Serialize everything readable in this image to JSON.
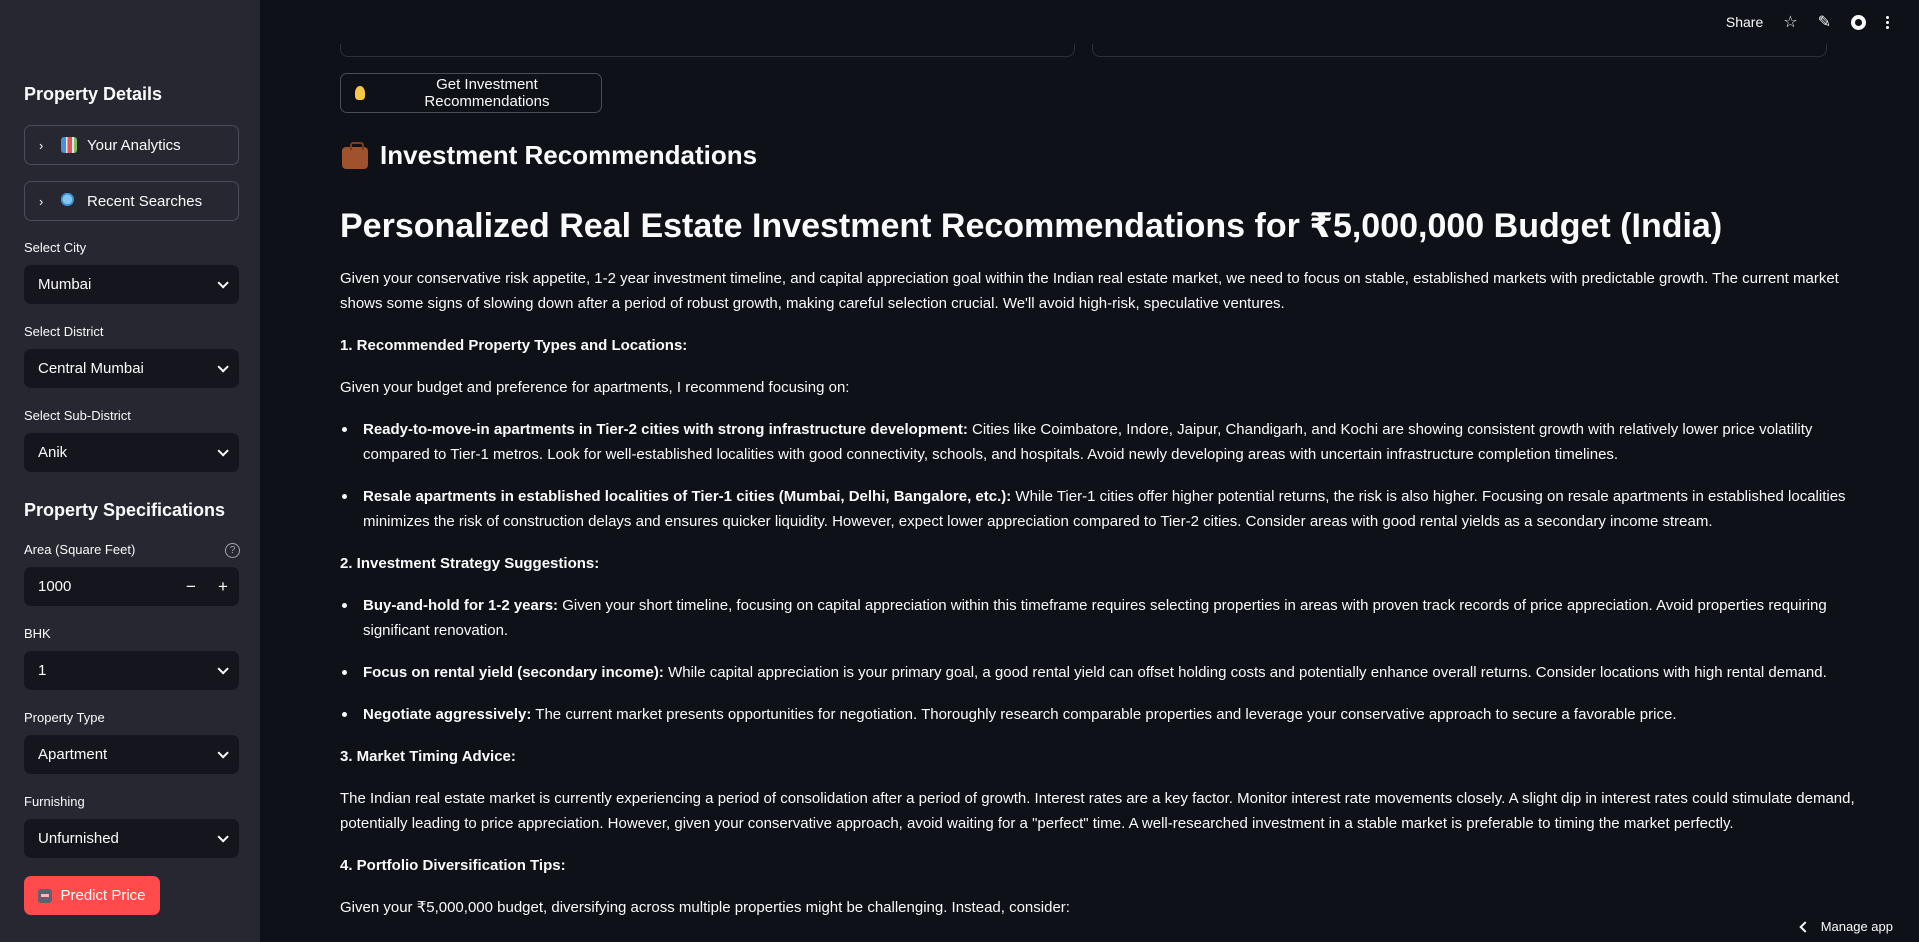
{
  "sidebar": {
    "title": "Property Details",
    "expanders": [
      {
        "label": "Your Analytics",
        "icon": "chart-icon"
      },
      {
        "label": "Recent Searches",
        "icon": "magnifier-icon"
      }
    ],
    "city": {
      "label": "Select City",
      "value": "Mumbai"
    },
    "district": {
      "label": "Select District",
      "value": "Central Mumbai"
    },
    "subdistrict": {
      "label": "Select Sub-District",
      "value": "Anik"
    },
    "spec_title": "Property Specifications",
    "area": {
      "label": "Area (Square Feet)",
      "value": "1000",
      "help": "?",
      "minus": "−",
      "plus": "+"
    },
    "bhk": {
      "label": "BHK",
      "value": "1"
    },
    "property_type": {
      "label": "Property Type",
      "value": "Apartment"
    },
    "furnishing": {
      "label": "Furnishing",
      "value": "Unfurnished"
    },
    "predict_label": "Predict Price"
  },
  "topbar": {
    "share": "Share",
    "star": "☆",
    "edit": "✎"
  },
  "main": {
    "rec_button_label": "Get Investment Recommendations",
    "rec_heading": "Investment Recommendations",
    "h1": "Personalized Real Estate Investment Recommendations for ₹5,000,000 Budget (India)",
    "intro": "Given your conservative risk appetite, 1-2 year investment timeline, and capital appreciation goal within the Indian real estate market, we need to focus on stable, established markets with predictable growth. The current market shows some signs of slowing down after a period of robust growth, making careful selection crucial. We'll avoid high-risk, speculative ventures.",
    "sec1_title": "1. Recommended Property Types and Locations:",
    "sec1_intro": "Given your budget and preference for apartments, I recommend focusing on:",
    "sec1_items": [
      {
        "bold": "Ready-to-move-in apartments in Tier-2 cities with strong infrastructure development:",
        "text": " Cities like Coimbatore, Indore, Jaipur, Chandigarh, and Kochi are showing consistent growth with relatively lower price volatility compared to Tier-1 metros. Look for well-established localities with good connectivity, schools, and hospitals. Avoid newly developing areas with uncertain infrastructure completion timelines."
      },
      {
        "bold": "Resale apartments in established localities of Tier-1 cities (Mumbai, Delhi, Bangalore, etc.):",
        "text": " While Tier-1 cities offer higher potential returns, the risk is also higher. Focusing on resale apartments in established localities minimizes the risk of construction delays and ensures quicker liquidity. However, expect lower appreciation compared to Tier-2 cities. Consider areas with good rental yields as a secondary income stream."
      }
    ],
    "sec2_title": "2. Investment Strategy Suggestions:",
    "sec2_items": [
      {
        "bold": "Buy-and-hold for 1-2 years:",
        "text": " Given your short timeline, focusing on capital appreciation within this timeframe requires selecting properties in areas with proven track records of price appreciation. Avoid properties requiring significant renovation."
      },
      {
        "bold": "Focus on rental yield (secondary income):",
        "text": " While capital appreciation is your primary goal, a good rental yield can offset holding costs and potentially enhance overall returns. Consider locations with high rental demand."
      },
      {
        "bold": "Negotiate aggressively:",
        "text": " The current market presents opportunities for negotiation. Thoroughly research comparable properties and leverage your conservative approach to secure a favorable price."
      }
    ],
    "sec3_title": "3. Market Timing Advice:",
    "sec3_text": "The Indian real estate market is currently experiencing a period of consolidation after a period of growth. Interest rates are a key factor. Monitor interest rate movements closely. A slight dip in interest rates could stimulate demand, potentially leading to price appreciation. However, given your conservative approach, avoid waiting for a \"perfect\" time. A well-researched investment in a stable market is preferable to timing the market perfectly.",
    "sec4_title": "4. Portfolio Diversification Tips:",
    "sec4_text": "Given your ₹5,000,000 budget, diversifying across multiple properties might be challenging. Instead, consider:",
    "manage_app": "Manage app"
  }
}
